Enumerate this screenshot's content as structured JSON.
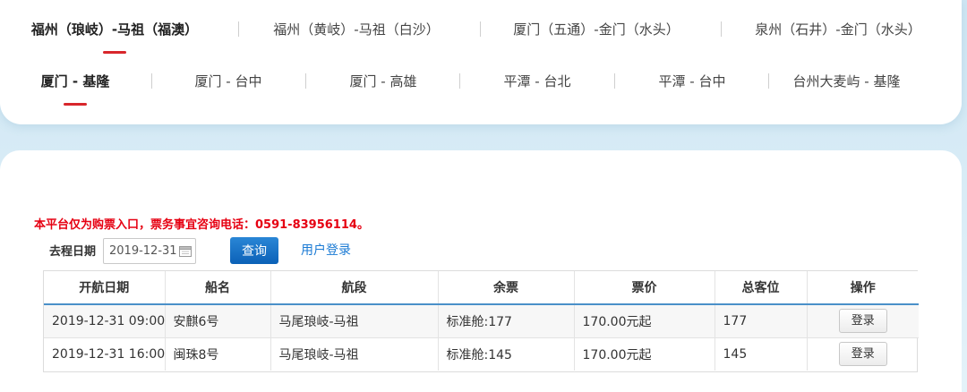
{
  "routes": {
    "row1": [
      {
        "label": "福州（琅岐）-马祖（福澳）",
        "active": true
      },
      {
        "label": "福州（黄岐）-马祖（白沙）",
        "active": false
      },
      {
        "label": "厦门（五通）-金门（水头）",
        "active": false
      },
      {
        "label": "泉州（石井）-金门（水头）",
        "active": false
      }
    ],
    "row2": [
      {
        "label": "厦门 - 基隆",
        "active": true
      },
      {
        "label": "厦门 - 台中",
        "active": false
      },
      {
        "label": "厦门 - 高雄",
        "active": false
      },
      {
        "label": "平潭 - 台北",
        "active": false
      },
      {
        "label": "平潭 - 台中",
        "active": false
      },
      {
        "label": "台州大麦屿 - 基隆",
        "active": false
      }
    ]
  },
  "notice": "本平台仅为购票入口，票务事宜咨询电话：0591-83956114。",
  "search": {
    "date_label": "去程日期",
    "date_value": "2019-12-31",
    "query_label": "查询",
    "login_link": "用户登录"
  },
  "table": {
    "headers": [
      "开航日期",
      "船名",
      "航段",
      "余票",
      "票价",
      "总客位",
      "操作"
    ],
    "rows": [
      {
        "date": "2019-12-31 09:00",
        "ship": "安麒6号",
        "route": "马尾琅岐-马祖",
        "tickets": "标准舱:177",
        "price": "170.00元起",
        "total": "177",
        "action": "登录"
      },
      {
        "date": "2019-12-31 16:00",
        "ship": "闽珠8号",
        "route": "马尾琅岐-马祖",
        "tickets": "标准舱:145",
        "price": "170.00元起",
        "total": "145",
        "action": "登录"
      }
    ]
  },
  "colors": {
    "accent_red": "#d8262b",
    "notice_red": "#e60012",
    "button_blue": "#0b61b7",
    "link_blue": "#1a7ad4"
  }
}
